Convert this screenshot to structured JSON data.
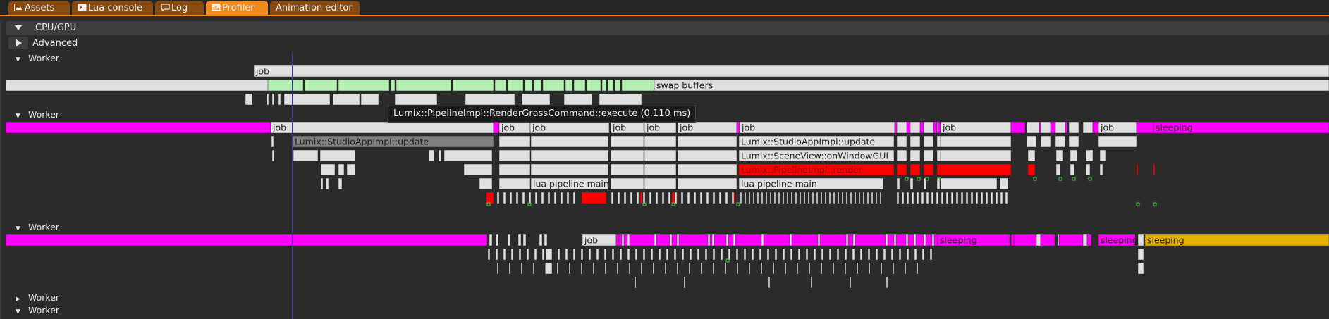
{
  "tabs": [
    {
      "label": "Assets",
      "icon": "image-icon",
      "active": false
    },
    {
      "label": "Lua console",
      "icon": "console-icon",
      "active": false
    },
    {
      "label": "Log",
      "icon": "comment-icon",
      "active": false
    },
    {
      "label": "Profiler",
      "icon": "chart-icon",
      "active": true
    },
    {
      "label": "Animation editor",
      "icon": "",
      "active": false
    }
  ],
  "section": {
    "label": "CPU/GPU",
    "expanded": true
  },
  "advanced": {
    "label": "Advanced"
  },
  "workers": [
    {
      "label": "Worker",
      "expanded": true
    },
    {
      "label": "Worker",
      "expanded": true
    },
    {
      "label": "Worker",
      "expanded": true
    },
    {
      "label": "Worker",
      "expanded": false
    },
    {
      "label": "Worker",
      "expanded": true
    }
  ],
  "tooltip": {
    "text": "Lumix::PipelineImpl::RenderGrassCommand::execute (0.110 ms)"
  },
  "labels": {
    "job": "job",
    "swap_buffers": "swap buffers",
    "sleeping": "sleeping",
    "studio_update": "Lumix::StudioAppImpl::update",
    "scene_view_gui": "Lumix::SceneView::onWindowGUI",
    "pipeline_render": "Lumix::PipelineImpl::render",
    "lua_pipeline_main": "lua pipeline main"
  },
  "colors": {
    "background": "#2b2b2b",
    "block": "#e0e0e0",
    "swap": "#b4f0b4",
    "waiting": "#ff00ff",
    "sleeping_gold": "#e8b000",
    "hot": "#ff0000",
    "selected_block": "#808080",
    "accent_tab": "#f08a1c",
    "cursor": "#3434c8"
  }
}
